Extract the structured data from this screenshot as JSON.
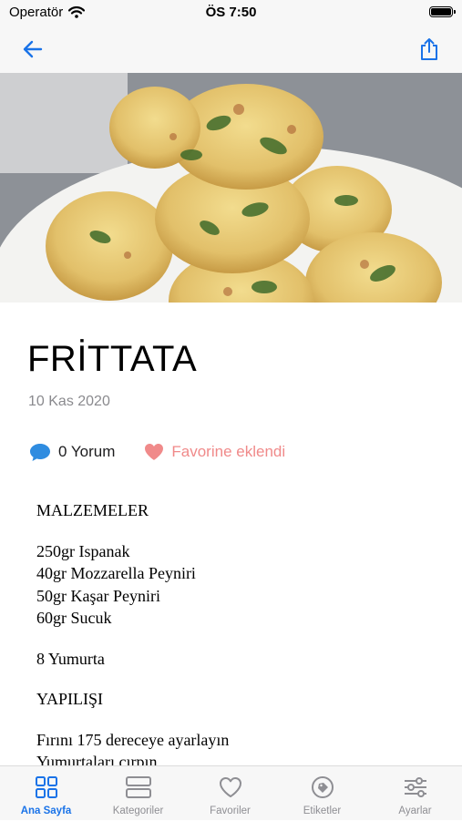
{
  "status_bar": {
    "carrier": "Operatör",
    "time": "ÖS 7:50"
  },
  "nav": {
    "back_icon": "arrow-left-icon",
    "share_icon": "share-icon"
  },
  "hero": {
    "image": "frittata-muffins-photo"
  },
  "recipe": {
    "title": "FRİTTATA",
    "date": "10 Kas 2020",
    "comments_label": "0 Yorum",
    "favorite_label": "Favorine eklendi",
    "accent_blue": "#1a73e8",
    "favorite_color": "#f08a8a",
    "body": {
      "heading_ingredients": "MALZEMELER",
      "ingredients": [
        "250gr Ispanak",
        "40gr Mozzarella Peyniri",
        "50gr Kaşar Peyniri",
        "60gr Sucuk"
      ],
      "eggs": "8 Yumurta",
      "heading_preparation": "YAPILIŞI",
      "steps": [
        "Fırını 175 dereceye ayarlayın",
        "Yumurtaları çırpın"
      ]
    }
  },
  "tabs": [
    {
      "label": "Ana Sayfa",
      "icon": "grid-icon",
      "active": true
    },
    {
      "label": "Kategoriler",
      "icon": "list-icon",
      "active": false
    },
    {
      "label": "Favoriler",
      "icon": "heart-icon",
      "active": false
    },
    {
      "label": "Etiketler",
      "icon": "tag-icon",
      "active": false
    },
    {
      "label": "Ayarlar",
      "icon": "sliders-icon",
      "active": false
    }
  ]
}
